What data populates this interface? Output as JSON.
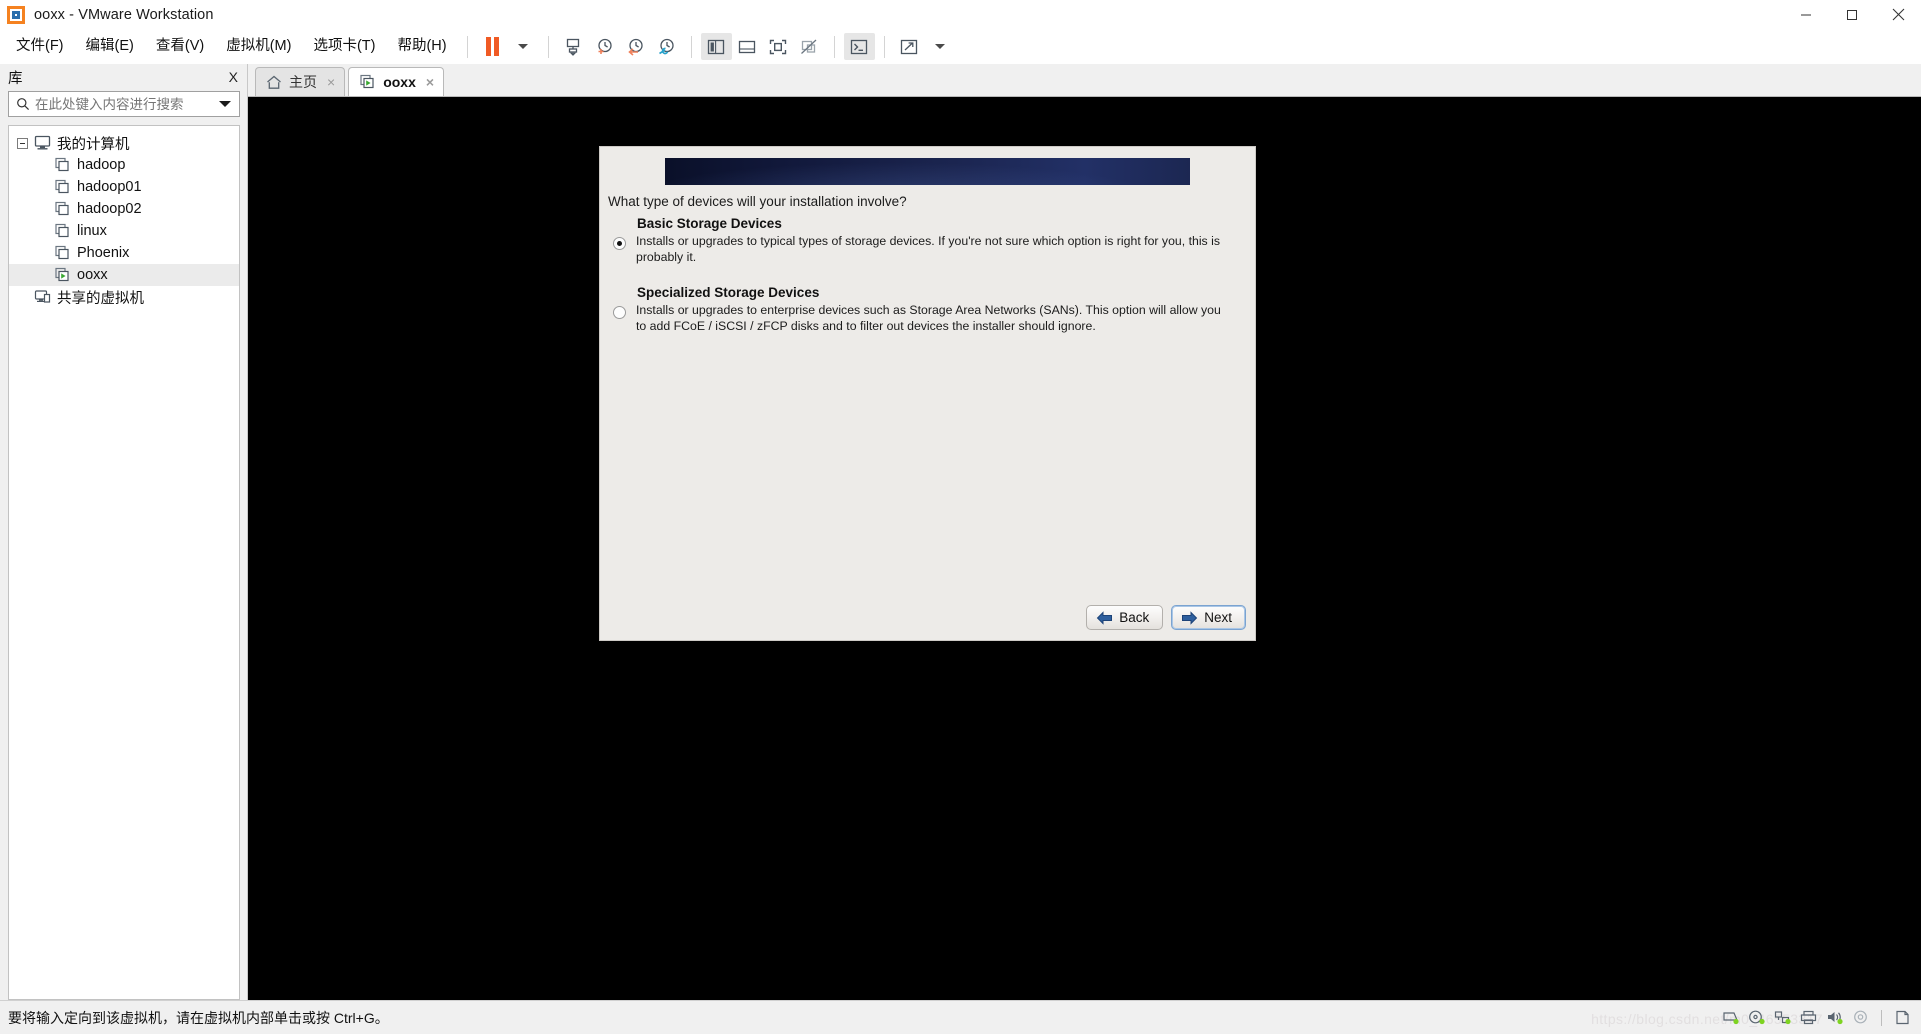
{
  "window": {
    "title": "ooxx - VMware Workstation",
    "minimize_label": "Minimize",
    "maximize_label": "Maximize",
    "close_label": "Close"
  },
  "menubar": {
    "items": [
      {
        "label": "文件(F)",
        "name": "menu-file"
      },
      {
        "label": "编辑(E)",
        "name": "menu-edit"
      },
      {
        "label": "查看(V)",
        "name": "menu-view"
      },
      {
        "label": "虚拟机(M)",
        "name": "menu-vm"
      },
      {
        "label": "选项卡(T)",
        "name": "menu-tabs"
      },
      {
        "label": "帮助(H)",
        "name": "menu-help"
      }
    ]
  },
  "toolbar": {
    "buttons": [
      {
        "name": "suspend-button",
        "icon": "pause-icon",
        "label": "挂起"
      },
      {
        "name": "power-dropdown",
        "icon": "chevron-down-icon",
        "label": "电源选项"
      },
      {
        "name": "snapshot-manager-button",
        "icon": "snapshot-icon",
        "label": "快照管理器"
      },
      {
        "name": "take-snapshot-button",
        "icon": "clock-plus-icon",
        "label": "创建快照"
      },
      {
        "name": "revert-snapshot-button",
        "icon": "clock-back-icon",
        "label": "恢复快照"
      },
      {
        "name": "manage-snapshots-button",
        "icon": "clock-wrench-icon",
        "label": "管理快照"
      },
      {
        "name": "show-library-button",
        "icon": "sidebar-panel-icon",
        "label": "显示库"
      },
      {
        "name": "show-thumbnails-button",
        "icon": "bottom-panel-icon",
        "label": "显示缩略图栏"
      },
      {
        "name": "fullscreen-button",
        "icon": "fullscreen-icon",
        "label": "全屏"
      },
      {
        "name": "unity-button",
        "icon": "unity-icon",
        "label": "Unity 模式"
      },
      {
        "name": "console-button",
        "icon": "terminal-icon",
        "label": "控制台视图"
      },
      {
        "name": "stretch-button",
        "icon": "expand-arrows-icon",
        "label": "自由拉伸"
      },
      {
        "name": "stretch-dropdown",
        "icon": "chevron-down-icon",
        "label": "拉伸选项"
      }
    ]
  },
  "sidebar": {
    "title": "库",
    "close_label": "X",
    "search": {
      "placeholder": "在此处键入内容进行搜索",
      "value": "",
      "icon": "search-icon"
    },
    "tree": {
      "root": {
        "label": "我的计算机",
        "icon": "computer-icon",
        "expanded": true
      },
      "items": [
        {
          "label": "hadoop",
          "icon": "vm-icon",
          "running": false,
          "selected": false
        },
        {
          "label": "hadoop01",
          "icon": "vm-icon",
          "running": false,
          "selected": false
        },
        {
          "label": "hadoop02",
          "icon": "vm-icon",
          "running": false,
          "selected": false
        },
        {
          "label": "linux",
          "icon": "vm-icon",
          "running": false,
          "selected": false
        },
        {
          "label": "Phoenix",
          "icon": "vm-icon",
          "running": false,
          "selected": false
        },
        {
          "label": "ooxx",
          "icon": "vm-running-icon",
          "running": true,
          "selected": true
        }
      ],
      "shared": {
        "label": "共享的虚拟机",
        "icon": "shared-vm-icon"
      }
    }
  },
  "tabs": [
    {
      "label": "主页",
      "icon": "home-icon",
      "active": false,
      "close_label": "×"
    },
    {
      "label": "ooxx",
      "icon": "vm-running-icon",
      "active": true,
      "close_label": "×"
    }
  ],
  "installer": {
    "banner_alt": "CentOS banner",
    "question": "What type of devices will your installation involve?",
    "options": [
      {
        "title": "Basic Storage Devices",
        "description": "Installs or upgrades to typical types of storage devices.  If you're not sure which option is right for you, this is probably it.",
        "selected": true
      },
      {
        "title": "Specialized Storage Devices",
        "description": "Installs or upgrades to enterprise devices such as Storage Area Networks (SANs). This option will allow you to add FCoE / iSCSI / zFCP disks and to filter out devices the installer should ignore.",
        "selected": false
      }
    ],
    "back_label": "Back",
    "next_label": "Next"
  },
  "statusbar": {
    "message": "要将输入定向到该虚拟机，请在虚拟机内部单击或按 Ctrl+G。",
    "watermark": "https://blog.csdn.net/m0_46553317",
    "icons": [
      {
        "name": "hard-disk-icon",
        "label": "硬盘"
      },
      {
        "name": "cd-dvd-icon",
        "label": "CD/DVD"
      },
      {
        "name": "network-adapter-icon",
        "label": "网络适配器"
      },
      {
        "name": "printer-icon",
        "label": "打印机"
      },
      {
        "name": "sound-card-icon",
        "label": "声卡"
      },
      {
        "name": "usb-icon",
        "label": "USB 控制器"
      },
      {
        "name": "message-log-icon",
        "label": "消息日志"
      }
    ]
  },
  "colors": {
    "accent_orange": "#f05a24",
    "banner_navy": "#11183a",
    "running_green": "#3aa832",
    "window_bg": "#f0f0f0",
    "installer_bg": "#edebe8"
  }
}
